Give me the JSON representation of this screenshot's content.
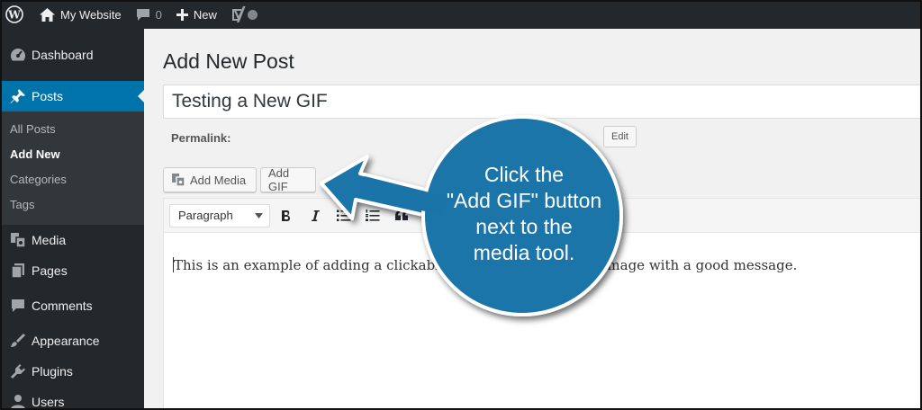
{
  "adminbar": {
    "site_name": "My Website",
    "comments_count": "0",
    "new_label": "New"
  },
  "sidebar": {
    "items_top": [
      {
        "label": "Dashboard",
        "icon": "dashboard-icon"
      },
      {
        "label": "Posts",
        "icon": "pin-icon"
      }
    ],
    "submenu": [
      "All Posts",
      "Add New",
      "Categories",
      "Tags"
    ],
    "items_bottom": [
      {
        "label": "Media",
        "icon": "media-icon"
      },
      {
        "label": "Pages",
        "icon": "pages-icon"
      },
      {
        "label": "Comments",
        "icon": "comments-icon"
      },
      {
        "label": "Appearance",
        "icon": "appearance-icon"
      },
      {
        "label": "Plugins",
        "icon": "plugins-icon"
      },
      {
        "label": "Users",
        "icon": "users-icon"
      }
    ]
  },
  "main": {
    "page_title": "Add New Post",
    "post_title": "Testing a New GIF",
    "permalink_label": "Permalink:",
    "edit_label": "Edit",
    "add_media_label": "Add Media",
    "add_gif_label": "Add GIF",
    "format_select": "Paragraph",
    "content_left": "This is an example of adding a clickable G",
    "content_right": "image with a good message."
  },
  "callout": {
    "lines": [
      "Click the",
      "\"Add GIF\" button",
      "next to the",
      "media tool."
    ]
  },
  "colors": {
    "adminbar_bg": "#23282d",
    "accent": "#0073aa",
    "callout_fill": "#1a74a8"
  }
}
